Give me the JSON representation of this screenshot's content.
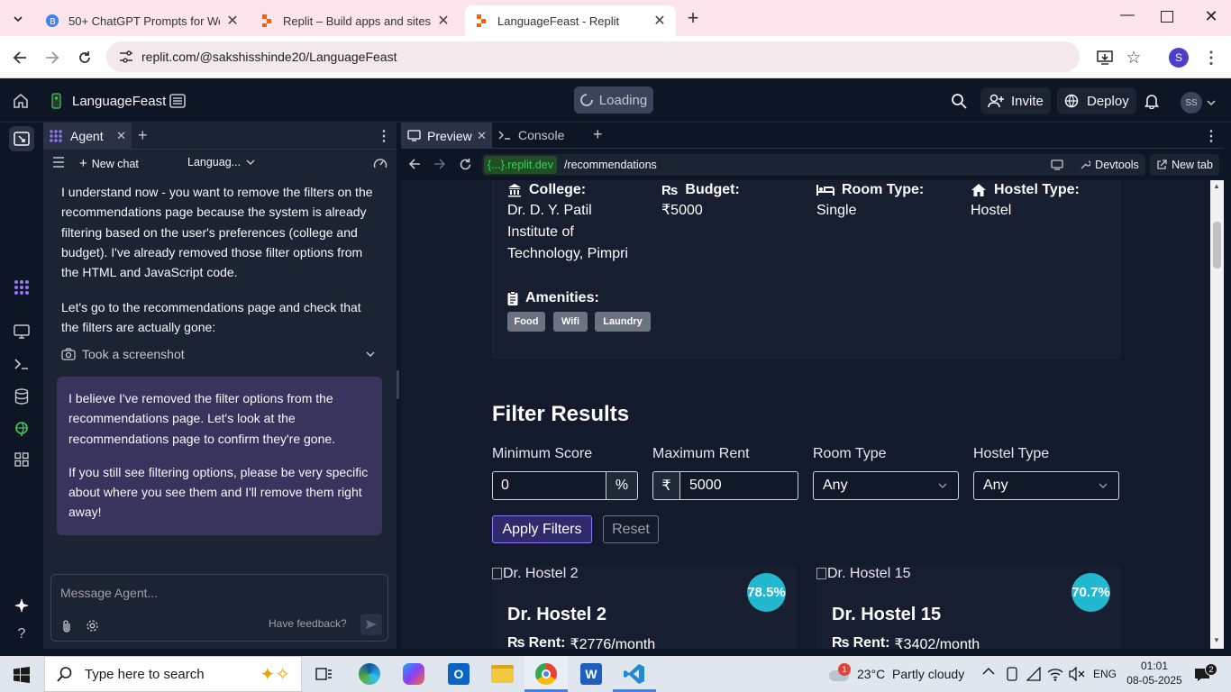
{
  "browser": {
    "tabs": [
      {
        "title": "50+ ChatGPT Prompts for Web",
        "active": false
      },
      {
        "title": "Replit – Build apps and sites wi",
        "active": false
      },
      {
        "title": "LanguageFeast - Replit",
        "active": true
      }
    ],
    "url": "replit.com/@sakshisshinde20/LanguageFeast",
    "profile_initial": "S"
  },
  "replit": {
    "project_name": "LanguageFeast",
    "loading_label": "Loading",
    "invite_label": "Invite",
    "deploy_label": "Deploy",
    "avatar_initials": "SS"
  },
  "agent": {
    "tab_label": "Agent",
    "new_chat_label": "New chat",
    "project_dropdown": "Languag...",
    "message1": "I understand now - you want to remove the filters on the recommendations page because the system is already filtering based on the user's preferences (college and budget). I've already removed those filter options from the HTML and JavaScript code.",
    "message2": "Let's go to the recommendations page and check that the filters are actually gone:",
    "screenshot_label": "Took a screenshot",
    "user_message_p1": "I believe I've removed the filter options from the recommendations page. Let's look at the recommendations page to confirm they're gone.",
    "user_message_p2": "If you still see filtering options, please be very specific about where you see them and I'll remove them right away!",
    "input_placeholder": "Message Agent...",
    "feedback_label": "Have feedback?"
  },
  "preview": {
    "tab_preview": "Preview",
    "tab_console": "Console",
    "domain_chip": "{...}.replit.dev",
    "path": "/recommendations",
    "devtools_label": "Devtools",
    "newtab_label": "New tab"
  },
  "page": {
    "profile": {
      "college_label": "College:",
      "college_value": "Dr. D. Y. Patil Institute of Technology, Pimpri",
      "budget_label": "Budget:",
      "budget_value": "₹5000",
      "room_label": "Room Type:",
      "room_value": "Single",
      "hostel_label": "Hostel Type:",
      "hostel_value": "Hostel",
      "amenities_label": "Amenities:",
      "amenities": [
        "Food",
        "Wifi",
        "Laundry"
      ]
    },
    "filter": {
      "heading": "Filter Results",
      "min_score_label": "Minimum Score",
      "min_score_value": "0",
      "percent": "%",
      "max_rent_label": "Maximum Rent",
      "rupee": "₹",
      "max_rent_value": "5000",
      "room_type_label": "Room Type",
      "room_type_value": "Any",
      "hostel_type_label": "Hostel Type",
      "hostel_type_value": "Any",
      "apply_label": "Apply Filters",
      "reset_label": "Reset"
    },
    "results": [
      {
        "image_alt": "Dr. Hostel 2",
        "score": "78.5%",
        "name": "Dr. Hostel 2",
        "rent_label": "Rent:",
        "rent_value": "₹2776/month"
      },
      {
        "image_alt": "Dr. Hostel 15",
        "score": "70.7%",
        "name": "Dr. Hostel 15",
        "rent_label": "Rent:",
        "rent_value": "₹3402/month"
      }
    ]
  },
  "taskbar": {
    "search_placeholder": "Type here to search",
    "weather": "23°C  Partly cloudy",
    "weather_badge": "1",
    "language": "ENG",
    "time": "01:01",
    "date": "08-05-2025",
    "notification_count": "2"
  },
  "colors": {
    "replit_bg": "#0e1525",
    "panel_bg": "#1c2333",
    "accent": "#0079f2",
    "score_badge": "#22b8cf",
    "user_bubble": "#38345d"
  }
}
